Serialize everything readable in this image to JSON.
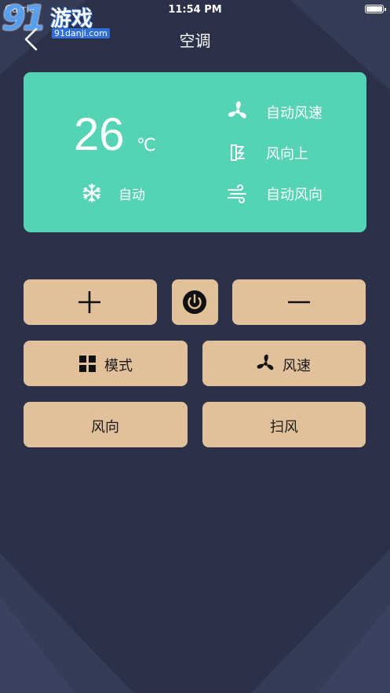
{
  "status_bar": {
    "carrier": "Carrier",
    "time": "11:54 PM"
  },
  "watermark": {
    "number": "91",
    "text": "游戏",
    "url": "91danji.com"
  },
  "nav": {
    "title": "空调"
  },
  "status_card": {
    "temperature": "26",
    "unit": "℃",
    "mode_label": "自动",
    "fan_speed_label": "自动风速",
    "wind_direction_label": "风向上",
    "auto_direction_label": "自动风向",
    "background_color": "#55d3b5"
  },
  "controls": {
    "increase_icon": "plus-icon",
    "power_icon": "power-icon",
    "decrease_icon": "minus-icon",
    "mode_label": "模式",
    "fan_speed_label": "风速",
    "direction_label": "风向",
    "swing_label": "扫风",
    "button_color": "#e2c09a"
  },
  "theme": {
    "background": "#2b3148",
    "accent": "#55d3b5"
  }
}
